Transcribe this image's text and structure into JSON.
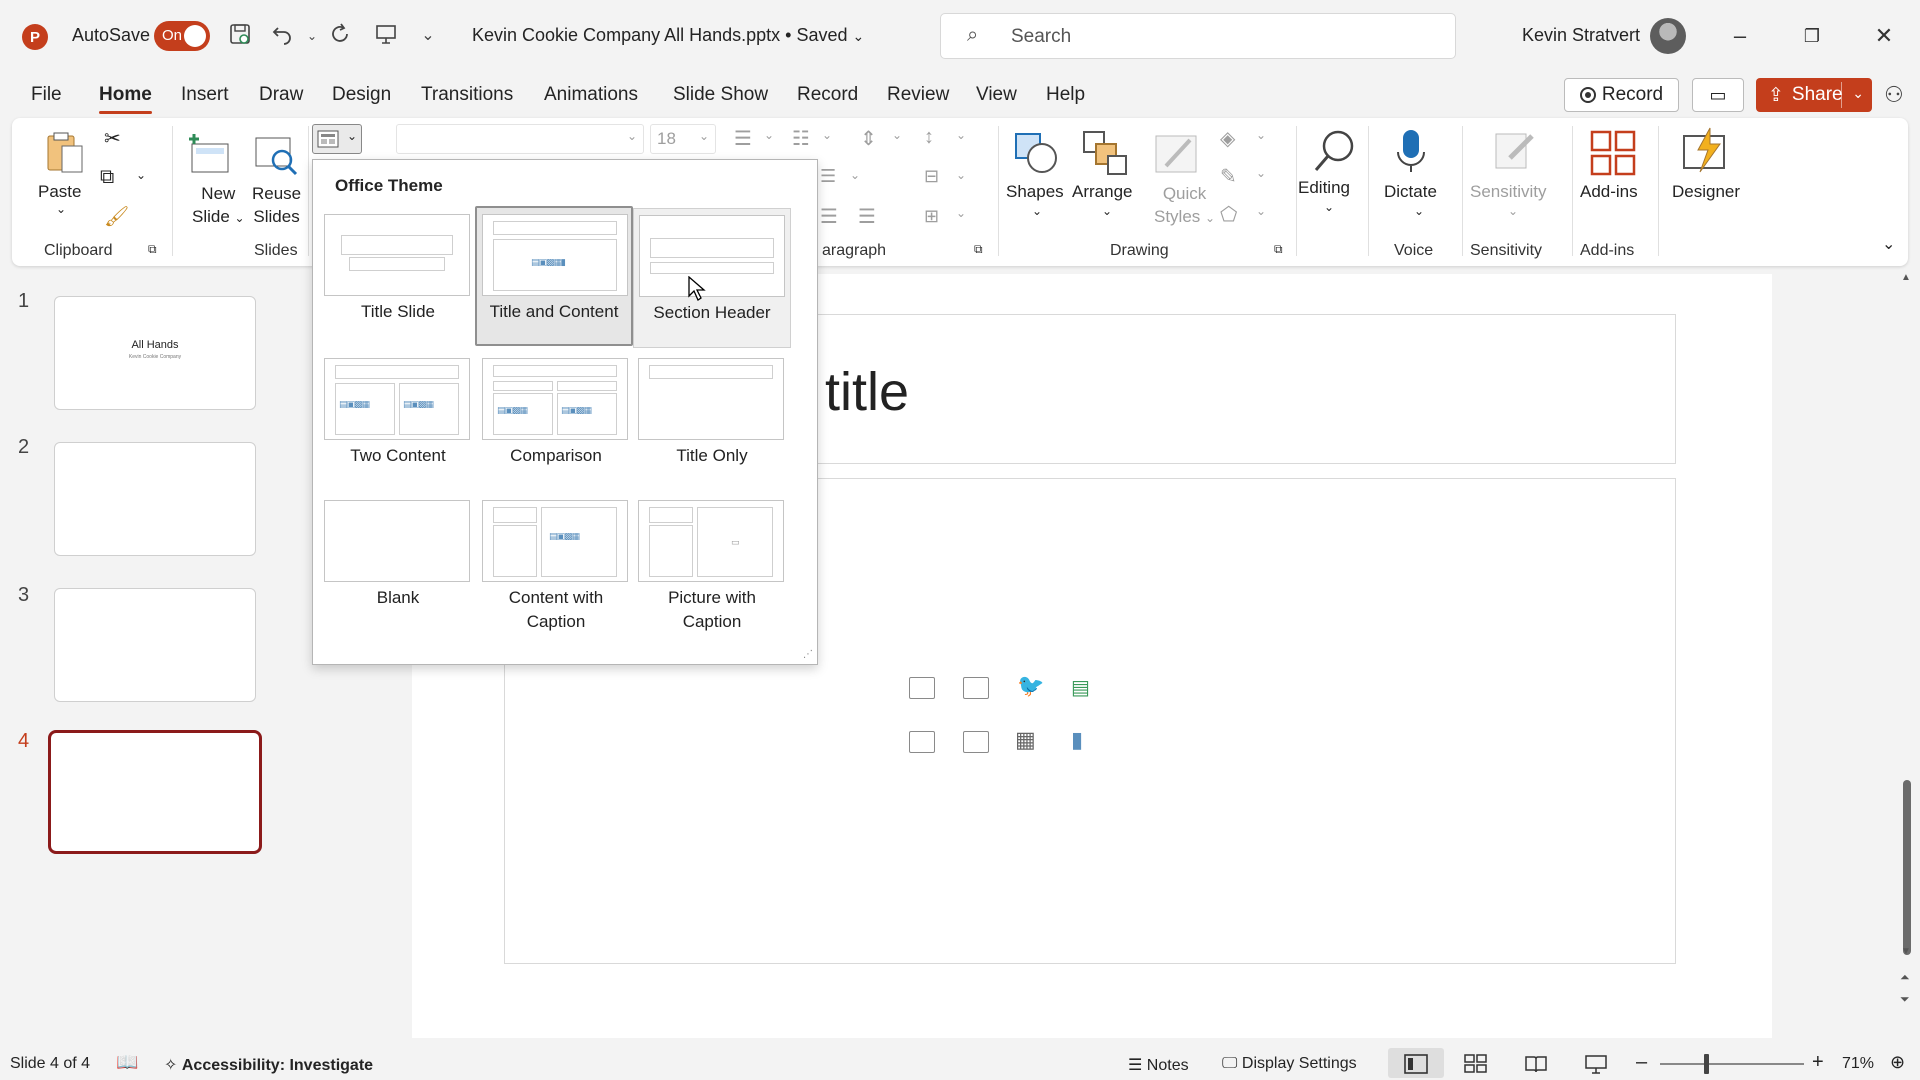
{
  "titlebar": {
    "app_logo": "P",
    "autosave_label": "AutoSave",
    "autosave_state": "On",
    "doc_title": "Kevin Cookie Company All Hands.pptx • Saved",
    "search_placeholder": "Search",
    "user_name": "Kevin Stratvert"
  },
  "tabs": [
    "File",
    "Home",
    "Insert",
    "Draw",
    "Design",
    "Transitions",
    "Animations",
    "Slide Show",
    "Record",
    "Review",
    "View",
    "Help"
  ],
  "actions": {
    "record_label": "Record",
    "share_label": "Share"
  },
  "ribbon": {
    "paste": "Paste",
    "clipboard_group": "Clipboard",
    "new_slide": "New",
    "new_slide_2": "Slide",
    "reuse_slides": "Reuse",
    "reuse_slides_2": "Slides",
    "slides_group": "Slides",
    "font_size": "18",
    "paragraph_group": "aragraph",
    "shapes": "Shapes",
    "arrange": "Arrange",
    "quick_styles": "Quick",
    "quick_styles_2": "Styles",
    "drawing_group": "Drawing",
    "editing": "Editing",
    "dictate": "Dictate",
    "voice_group": "Voice",
    "sensitivity": "Sensitivity",
    "sensitivity_group": "Sensitivity",
    "addins": "Add-ins",
    "addins_group": "Add-ins",
    "designer": "Designer"
  },
  "layout_menu": {
    "header": "Office Theme",
    "layouts": [
      {
        "name": "Title Slide"
      },
      {
        "name": "Title and Content"
      },
      {
        "name": "Section Header"
      },
      {
        "name": "Two Content"
      },
      {
        "name": "Comparison"
      },
      {
        "name": "Title Only"
      },
      {
        "name": "Blank"
      },
      {
        "name": "Content with Caption"
      },
      {
        "name": "Picture with Caption"
      }
    ],
    "selected": "Title and Content",
    "hovered": "Section Header"
  },
  "thumbnails": [
    {
      "num": "1",
      "title": "All Hands",
      "subtitle": "Kevin Cookie Company"
    },
    {
      "num": "2"
    },
    {
      "num": "3"
    },
    {
      "num": "4"
    }
  ],
  "slide": {
    "title_placeholder_visible": "title"
  },
  "statusbar": {
    "slide_counter": "Slide 4 of 4",
    "accessibility": "Accessibility: Investigate",
    "notes": "Notes",
    "display_settings": "Display Settings",
    "zoom": "71%"
  },
  "colors": {
    "accent": "#c43e1c",
    "active_thumb_border": "#8b1a1a"
  }
}
